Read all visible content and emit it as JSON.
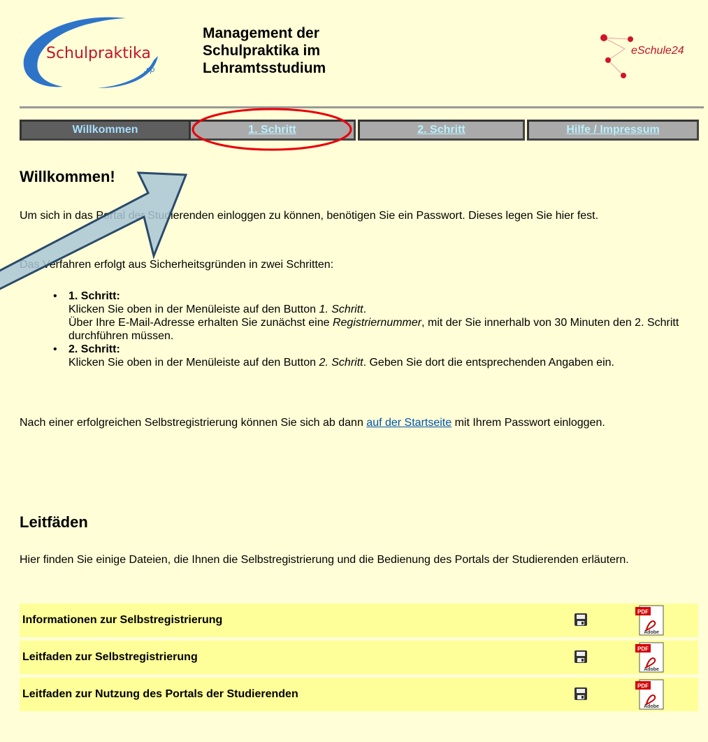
{
  "header": {
    "logo_left_text_main": "Schulpraktika",
    "logo_left_text_sub": ".rlp",
    "title_line1": "Management der",
    "title_line2": "Schulpraktika im",
    "title_line3": "Lehramtsstudium",
    "logo_right_text": "eSchule24"
  },
  "menu": {
    "items": [
      {
        "label": "Willkommen",
        "state": "active"
      },
      {
        "label": "1. Schritt",
        "state": "inactive"
      },
      {
        "label": "2. Schritt",
        "state": "inactive"
      },
      {
        "label": "Hilfe / Impressum",
        "state": "inactive"
      }
    ]
  },
  "welcome": {
    "heading": "Willkommen!",
    "p1": "Um sich in das Portal der Studierenden einloggen zu können, benötigen Sie ein Passwort. Dieses legen Sie hier fest.",
    "p2": "Das Verfahren erfolgt aus Sicherheitsgründen in zwei Schritten:",
    "step1_title": "1. Schritt:",
    "step1_line1_a": "Klicken Sie oben in der Menüleiste auf den Button ",
    "step1_line1_em": "1. Schritt",
    "step1_line1_b": ".",
    "step1_line2_a": "Über Ihre E-Mail-Adresse erhalten Sie zunächst eine ",
    "step1_line2_em": "Registriernummer",
    "step1_line2_b": ", mit der Sie innerhalb von 30 Minuten den 2. Schritt durchführen müssen.",
    "step2_title": "2. Schritt:",
    "step2_a": "Klicken Sie oben in der Menüleiste auf den Button ",
    "step2_em": "2. Schritt",
    "step2_b": ". Geben Sie dort die entsprechenden Angaben ein.",
    "p3_a": "Nach einer erfolgreichen Selbstregistrierung können Sie sich ab dann ",
    "p3_link": "auf der Startseite",
    "p3_b": " mit Ihrem Passwort einloggen."
  },
  "guides": {
    "heading": "Leitfäden",
    "intro": "Hier finden Sie einige Dateien, die Ihnen die Selbstregistrierung und die Bedienung des Portals der Studierenden erläutern.",
    "rows": [
      {
        "label": "Informationen zur Selbstregistrierung"
      },
      {
        "label": "Leitfaden zur Selbstregistrierung"
      },
      {
        "label": "Leitfaden zur Nutzung des Portals der Studierenden"
      }
    ],
    "pdf_badge": "PDF",
    "pdf_brand": "Adobe"
  },
  "colors": {
    "page_bg": "#fffed7",
    "row_bg": "#ffff99",
    "menu_active_bg": "#5e5e5e",
    "menu_inactive_bg": "#aaaaaa",
    "menu_text": "#b9f0ff",
    "link": "#0051b0",
    "annotation_red": "#e8000a",
    "arrow_fill": "#a9c7d6",
    "arrow_stroke": "#2b4a6b"
  }
}
